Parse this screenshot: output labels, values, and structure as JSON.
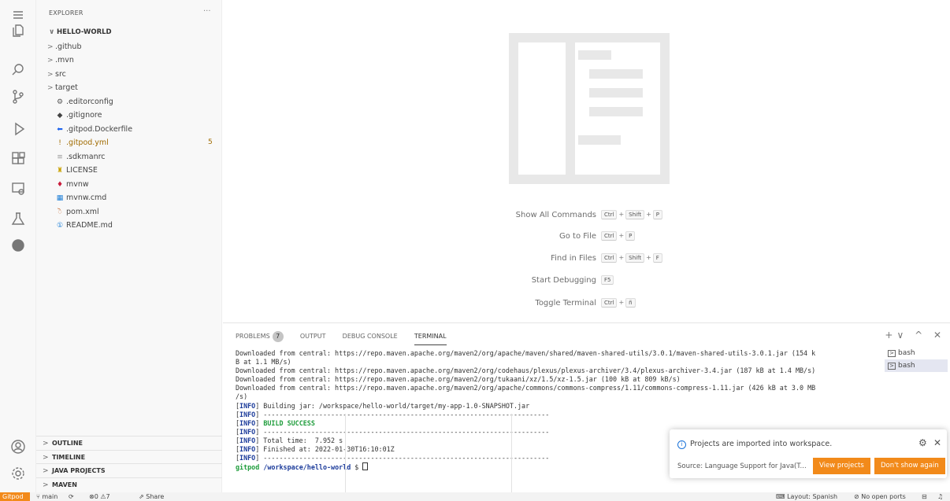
{
  "activity_bar": {
    "items": [
      "menu-icon",
      "explorer-icon",
      "search-icon",
      "source-control-icon",
      "run-debug-icon",
      "extensions-icon",
      "remote-explorer-icon",
      "testing-icon",
      "github-icon",
      "account-icon",
      "manage-icon"
    ]
  },
  "sidebar": {
    "title": "EXPLORER",
    "more": "···",
    "root": "HELLO-WORLD",
    "root_chevron": "∨",
    "folders": [
      {
        "label": ".github"
      },
      {
        "label": ".mvn"
      },
      {
        "label": "src"
      },
      {
        "label": "target"
      }
    ],
    "folder_chevron": ">",
    "files": [
      {
        "label": ".editorconfig",
        "icon": "⚙",
        "color": "#555555"
      },
      {
        "label": ".gitignore",
        "icon": "◆",
        "color": "#444444"
      },
      {
        "label": ".gitpod.Dockerfile",
        "icon": "⬅",
        "color": "#1d63ed"
      },
      {
        "label": ".gitpod.yml",
        "icon": "!",
        "color": "#a06b00",
        "badge": "5"
      },
      {
        "label": ".sdkmanrc",
        "icon": "≡",
        "color": "#999999"
      },
      {
        "label": "LICENSE",
        "icon": "♜",
        "color": "#c9a200"
      },
      {
        "label": "mvnw",
        "icon": "♦",
        "color": "#c91d3c"
      },
      {
        "label": "mvnw.cmd",
        "icon": "▦",
        "color": "#1d7ed6"
      },
      {
        "label": "pom.xml",
        "icon": "ॆ",
        "color": "#c05a1a"
      },
      {
        "label": "README.md",
        "icon": "①",
        "color": "#1d7ed6"
      }
    ],
    "panels": [
      {
        "label": "OUTLINE"
      },
      {
        "label": "TIMELINE"
      },
      {
        "label": "JAVA PROJECTS"
      },
      {
        "label": "MAVEN"
      }
    ]
  },
  "welcome": {
    "shortcuts": [
      {
        "label": "Show All Commands",
        "keys": [
          "Ctrl",
          "Shift",
          "P"
        ]
      },
      {
        "label": "Go to File",
        "keys": [
          "Ctrl",
          "P"
        ]
      },
      {
        "label": "Find in Files",
        "keys": [
          "Ctrl",
          "Shift",
          "F"
        ]
      },
      {
        "label": "Start Debugging",
        "keys": [
          "F5"
        ]
      },
      {
        "label": "Toggle Terminal",
        "keys": [
          "Ctrl",
          "ñ"
        ]
      }
    ]
  },
  "panel": {
    "tabs": {
      "problems": "PROBLEMS",
      "problems_count": "7",
      "output": "OUTPUT",
      "debug_console": "DEBUG CONSOLE",
      "terminal": "TERMINAL"
    },
    "actions": "+∨ ^ ✕",
    "terminal_lines": [
      "Downloaded from central: https://repo.maven.apache.org/maven2/org/apache/maven/shared/maven-shared-utils/3.0.1/maven-shared-utils-3.0.1.jar (154 k",
      "B at 1.1 MB/s)",
      "Downloaded from central: https://repo.maven.apache.org/maven2/org/codehaus/plexus/plexus-archiver/3.4/plexus-archiver-3.4.jar (187 kB at 1.4 MB/s)",
      "Downloaded from central: https://repo.maven.apache.org/maven2/org/tukaani/xz/1.5/xz-1.5.jar (100 kB at 809 kB/s)",
      "Downloaded from central: https://repo.maven.apache.org/maven2/org/apache/commons/commons-compress/1.11/commons-compress-1.11.jar (426 kB at 3.0 MB",
      "/s)"
    ],
    "info_tag": "INFO",
    "info_lines": [
      " Building jar: /workspace/hello-world/target/my-app-1.0-SNAPSHOT.jar",
      " ------------------------------------------------------------------------",
      " ",
      " ------------------------------------------------------------------------",
      " Total time:  7.952 s",
      " Finished at: 2022-01-30T16:10:01Z",
      " ------------------------------------------------------------------------"
    ],
    "build_success": "BUILD SUCCESS",
    "prompt_user": "gitpod",
    "prompt_dir": "/workspace/hello-world",
    "prompt_symbol": " $ ",
    "terminal_list": [
      "bash",
      "bash"
    ]
  },
  "notification": {
    "message": "Projects are imported into workspace.",
    "source": "Source: Language Support for Java(T...",
    "view_projects": "View projects",
    "dont_show": "Don't show again",
    "accent": "#f28a1a"
  },
  "status_bar": {
    "gitpod": "Gitpod",
    "branch": "main",
    "errors": "0",
    "warnings": "7",
    "share": "Share",
    "layout": "Layout: Spanish",
    "ports": "No open ports"
  }
}
